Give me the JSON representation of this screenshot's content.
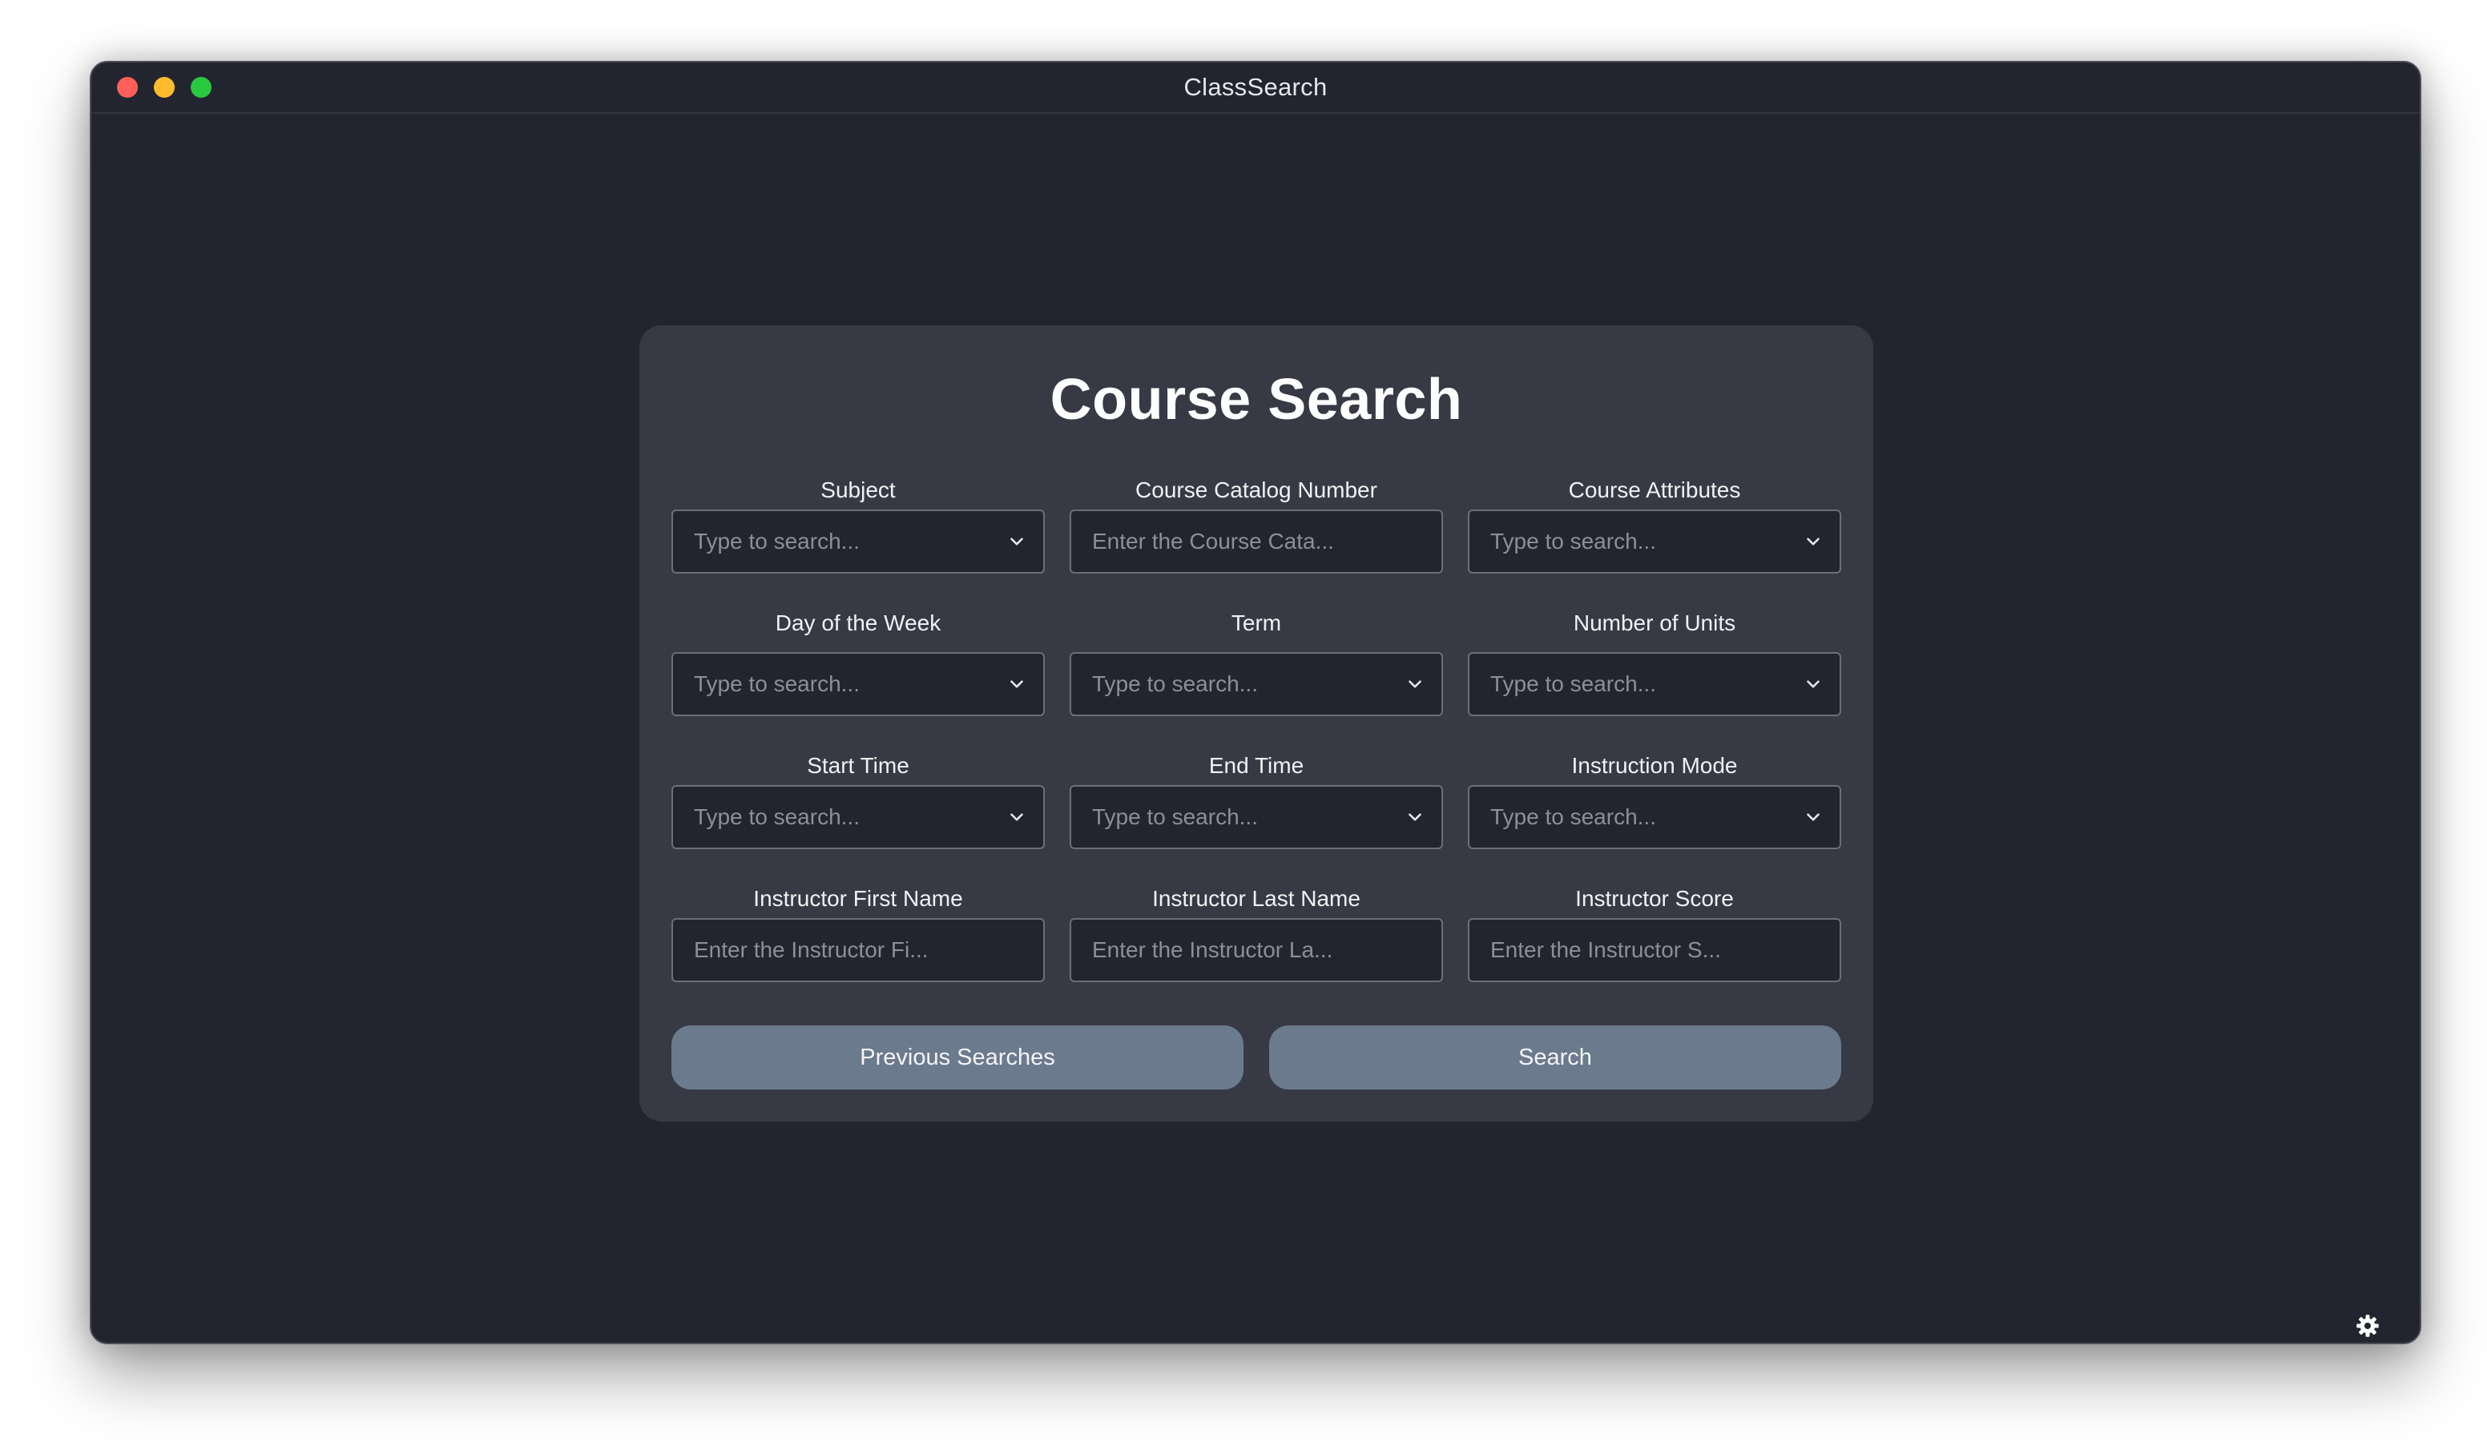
{
  "window": {
    "title": "ClassSearch"
  },
  "form": {
    "title": "Course Search",
    "fields": [
      {
        "label": "Subject",
        "type": "dropdown",
        "placeholder": "Type to search..."
      },
      {
        "label": "Course Catalog Number",
        "type": "text",
        "placeholder": "Enter the Course Cata..."
      },
      {
        "label": "Course Attributes",
        "type": "dropdown",
        "placeholder": "Type to search..."
      },
      {
        "label": "Day of the Week",
        "type": "dropdown",
        "placeholder": "Type to search..."
      },
      {
        "label": "Term",
        "type": "dropdown",
        "placeholder": "Type to search..."
      },
      {
        "label": "Number of Units",
        "type": "dropdown",
        "placeholder": "Type to search..."
      },
      {
        "label": "Start Time",
        "type": "dropdown",
        "placeholder": "Type to search..."
      },
      {
        "label": "End Time",
        "type": "dropdown",
        "placeholder": "Type to search..."
      },
      {
        "label": "Instruction Mode",
        "type": "dropdown",
        "placeholder": "Type to search..."
      },
      {
        "label": "Instructor First Name",
        "type": "text",
        "placeholder": "Enter the Instructor Fi..."
      },
      {
        "label": "Instructor Last Name",
        "type": "text",
        "placeholder": "Enter the Instructor La..."
      },
      {
        "label": "Instructor Score",
        "type": "text",
        "placeholder": "Enter the Instructor S..."
      }
    ],
    "buttons": {
      "previous_label": "Previous Searches",
      "search_label": "Search"
    }
  },
  "icons": {
    "dropdown": "chevron-down-icon",
    "settings": "gear-icon"
  },
  "colors": {
    "window_bg": "#22252f",
    "card_bg": "#373a45",
    "button_bg": "#6c7a8d"
  }
}
